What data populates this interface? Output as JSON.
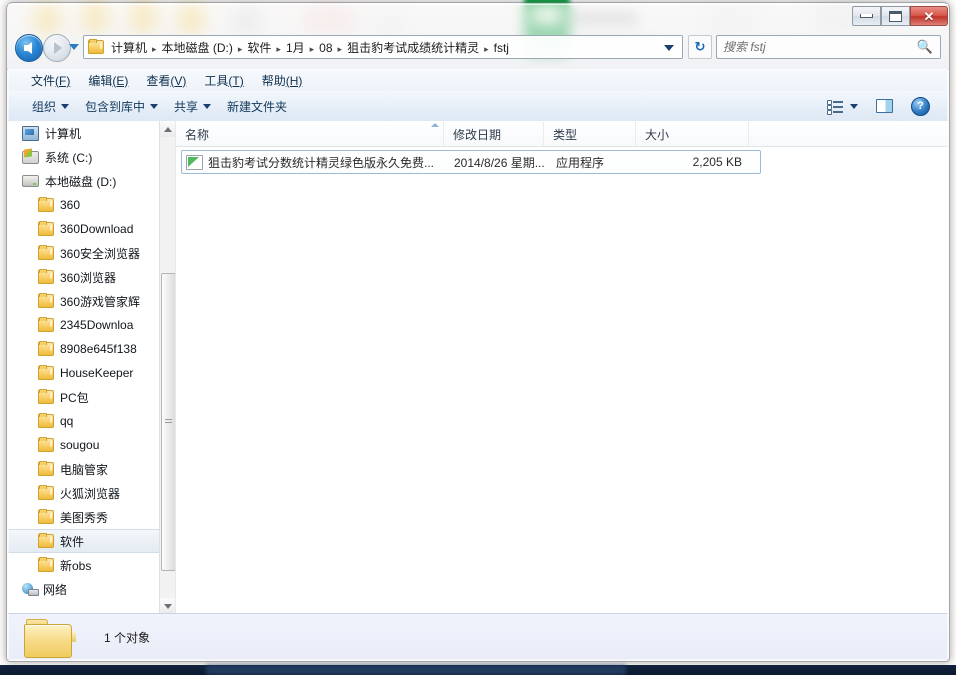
{
  "window": {
    "title": "",
    "controls": {
      "minimize": "minimize-button",
      "maximize": "maximize-button",
      "close": "✕"
    }
  },
  "nav": {
    "back_tooltip": "后退",
    "forward_tooltip": "前进",
    "refresh_glyph": "↻",
    "breadcrumbs": [
      "计算机",
      "本地磁盘 (D:)",
      "软件",
      "1月",
      "08",
      "狙击豹考试成绩统计精灵",
      "fstj"
    ],
    "separator": "▸"
  },
  "search": {
    "placeholder": "搜索 fstj",
    "value": "",
    "icon": "search-icon"
  },
  "menubar": {
    "items": [
      {
        "text": "文件",
        "mnemonic": "(F)"
      },
      {
        "text": "编辑",
        "mnemonic": "(E)"
      },
      {
        "text": "查看",
        "mnemonic": "(V)"
      },
      {
        "text": "工具",
        "mnemonic": "(T)"
      },
      {
        "text": "帮助",
        "mnemonic": "(H)"
      }
    ]
  },
  "toolbar": {
    "items": [
      {
        "label": "组织",
        "has_caret": true
      },
      {
        "label": "包含到库中",
        "has_caret": true
      },
      {
        "label": "共享",
        "has_caret": true
      },
      {
        "label": "新建文件夹",
        "has_caret": false
      }
    ],
    "right": {
      "view_icon": "view-options-icon",
      "view_caret": "chevron-down-icon",
      "preview_pane_icon": "preview-pane-icon",
      "help_icon": "help-icon",
      "help_glyph": "?"
    }
  },
  "navpane": {
    "items": [
      {
        "label": "计算机",
        "icon": "computer-icon",
        "depth": 0,
        "selected": false
      },
      {
        "label": "系统 (C:)",
        "icon": "system-drive-icon",
        "depth": 0,
        "selected": false
      },
      {
        "label": "本地磁盘 (D:)",
        "icon": "drive-icon",
        "depth": 0,
        "selected": false
      },
      {
        "label": "360",
        "icon": "folder-icon",
        "depth": 1,
        "selected": false
      },
      {
        "label": "360Download",
        "icon": "folder-icon",
        "depth": 1,
        "selected": false
      },
      {
        "label": "360安全浏览器",
        "icon": "folder-icon",
        "depth": 1,
        "selected": false
      },
      {
        "label": "360浏览器",
        "icon": "folder-icon",
        "depth": 1,
        "selected": false
      },
      {
        "label": "360游戏管家辉",
        "icon": "folder-icon",
        "depth": 1,
        "selected": false
      },
      {
        "label": "2345Downloa",
        "icon": "folder-icon",
        "depth": 1,
        "selected": false
      },
      {
        "label": "8908e645f138",
        "icon": "folder-icon",
        "depth": 1,
        "selected": false
      },
      {
        "label": "HouseKeeper",
        "icon": "folder-icon",
        "depth": 1,
        "selected": false
      },
      {
        "label": "PC包",
        "icon": "folder-icon",
        "depth": 1,
        "selected": false
      },
      {
        "label": "qq",
        "icon": "folder-icon",
        "depth": 1,
        "selected": false
      },
      {
        "label": "sougou",
        "icon": "folder-icon",
        "depth": 1,
        "selected": false
      },
      {
        "label": "电脑管家",
        "icon": "folder-icon",
        "depth": 1,
        "selected": false
      },
      {
        "label": "火狐浏览器",
        "icon": "folder-icon",
        "depth": 1,
        "selected": false
      },
      {
        "label": "美图秀秀",
        "icon": "folder-icon",
        "depth": 1,
        "selected": false
      },
      {
        "label": "软件",
        "icon": "folder-icon",
        "depth": 1,
        "selected": true
      },
      {
        "label": "新obs",
        "icon": "folder-icon",
        "depth": 1,
        "selected": false
      },
      {
        "label": "网络",
        "icon": "network-icon",
        "depth": 0,
        "selected": false
      }
    ],
    "scrollbar": {
      "up": "scroll-up-arrow",
      "down": "scroll-down-arrow"
    }
  },
  "filelist": {
    "columns": [
      {
        "label": "名称",
        "sorted": true,
        "sort_dir": "asc"
      },
      {
        "label": "修改日期",
        "sorted": false
      },
      {
        "label": "类型",
        "sorted": false
      },
      {
        "label": "大小",
        "sorted": false
      }
    ],
    "rows": [
      {
        "name": "狙击豹考试分数统计精灵绿色版永久免费...",
        "date": "2014/8/26 星期...",
        "type": "应用程序",
        "size": "2,205 KB",
        "icon": "application-icon",
        "selected": true
      }
    ]
  },
  "statusbar": {
    "icon": "folder-large-icon",
    "text": "1 个对象"
  },
  "colors": {
    "accent": "#2b87d4",
    "close_button": "#bf3529",
    "selection_border": "#9cb9d6",
    "folder_yellow": "#f0cb5d",
    "app_green": "#4fb95e"
  }
}
